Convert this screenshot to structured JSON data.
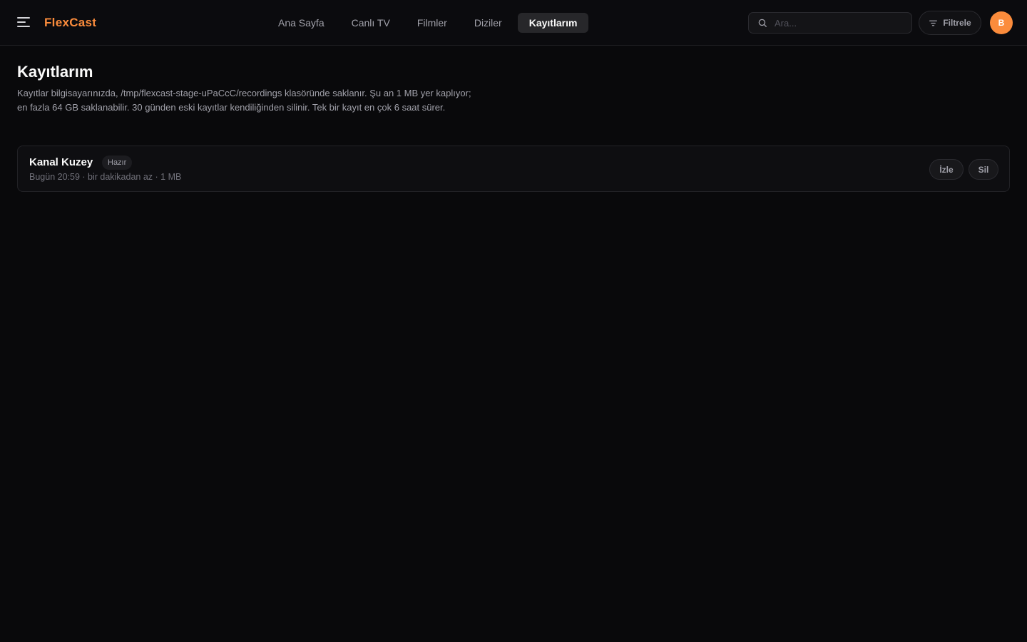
{
  "header": {
    "brand": "FlexCast",
    "nav": [
      {
        "label": "Ana Sayfa",
        "active": false
      },
      {
        "label": "Canlı TV",
        "active": false
      },
      {
        "label": "Filmler",
        "active": false
      },
      {
        "label": "Diziler",
        "active": false
      },
      {
        "label": "Kayıtlarım",
        "active": true
      }
    ],
    "search": {
      "placeholder": "Ara...",
      "value": "",
      "icon": "search-icon"
    },
    "filter_label": "Filtrele",
    "filter_icon": "filter-icon",
    "avatar_initial": "B"
  },
  "main": {
    "title": "Kayıtlarım",
    "description": "Kayıtlar bilgisayarınızda, /tmp/flexcast-stage-uPaCcC/recordings klasöründe saklanır. Şu an 1 MB yer kaplıyor; en fazla 64 GB saklanabilir. 30 günden eski kayıtlar kendiliğinden silinir. Tek bir kayıt en çok 6 saat sürer.",
    "recordings": [
      {
        "channel": "Kanal Kuzey",
        "status": "Hazır",
        "meta": "Bugün 20:59 · bir dakikadan az · 1 MB",
        "watch_label": "İzle",
        "delete_label": "Sil"
      }
    ]
  },
  "colors": {
    "accent": "#fb8c3c",
    "background": "#09090b",
    "card": "#0e0e11",
    "muted_text": "#a1a1aa"
  }
}
